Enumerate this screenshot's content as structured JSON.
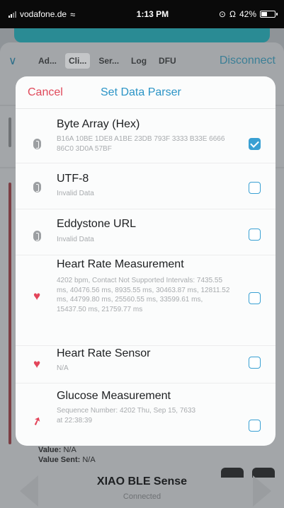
{
  "status_bar": {
    "carrier": "vodafone.de",
    "time": "1:13 PM",
    "battery": "42%"
  },
  "nav": {
    "tabs": [
      "Ad...",
      "Cli...",
      "Ser...",
      "Log",
      "DFU"
    ],
    "active_tab": "Cli...",
    "disconnect_label": "Disconnect"
  },
  "background": {
    "value_label": "Value:",
    "value": "N/A",
    "value_sent_label": "Value Sent:",
    "value_sent": "N/A"
  },
  "device": {
    "name": "XIAO BLE Sense",
    "status": "Connected"
  },
  "modal": {
    "cancel_label": "Cancel",
    "title": "Set Data Parser",
    "items": [
      {
        "title": "Byte Array (Hex)",
        "detail": "B16A 10BE 1DE8 A1BE 23DB 793F 3333 B33E 6666 86C0 3D0A 57BF",
        "icon": "bluetooth-icon",
        "checked": true
      },
      {
        "title": "UTF-8",
        "detail": "Invalid Data",
        "icon": "bluetooth-icon",
        "checked": false
      },
      {
        "title": "Eddystone URL",
        "detail": "Invalid Data",
        "icon": "bluetooth-icon",
        "checked": false
      },
      {
        "title": "Heart Rate Measurement",
        "detail": "4202 bpm, Contact Not Supported Intervals: 7435.55 ms, 40476.56 ms, 8935.55 ms, 30463.87 ms, 12811.52 ms, 44799.80 ms, 25560.55 ms, 33599.61 ms, 15437.50 ms, 21759.77 ms",
        "icon": "heart-icon",
        "checked": false
      },
      {
        "title": "Heart Rate Sensor",
        "detail": "N/A",
        "icon": "heart-icon",
        "checked": false
      },
      {
        "title": "Glucose Measurement",
        "detail": "Sequence Number: 4202 Thu, Sep 15, 7633 at 22:38:39",
        "icon": "glucose-drop-icon",
        "checked": false
      }
    ]
  }
}
